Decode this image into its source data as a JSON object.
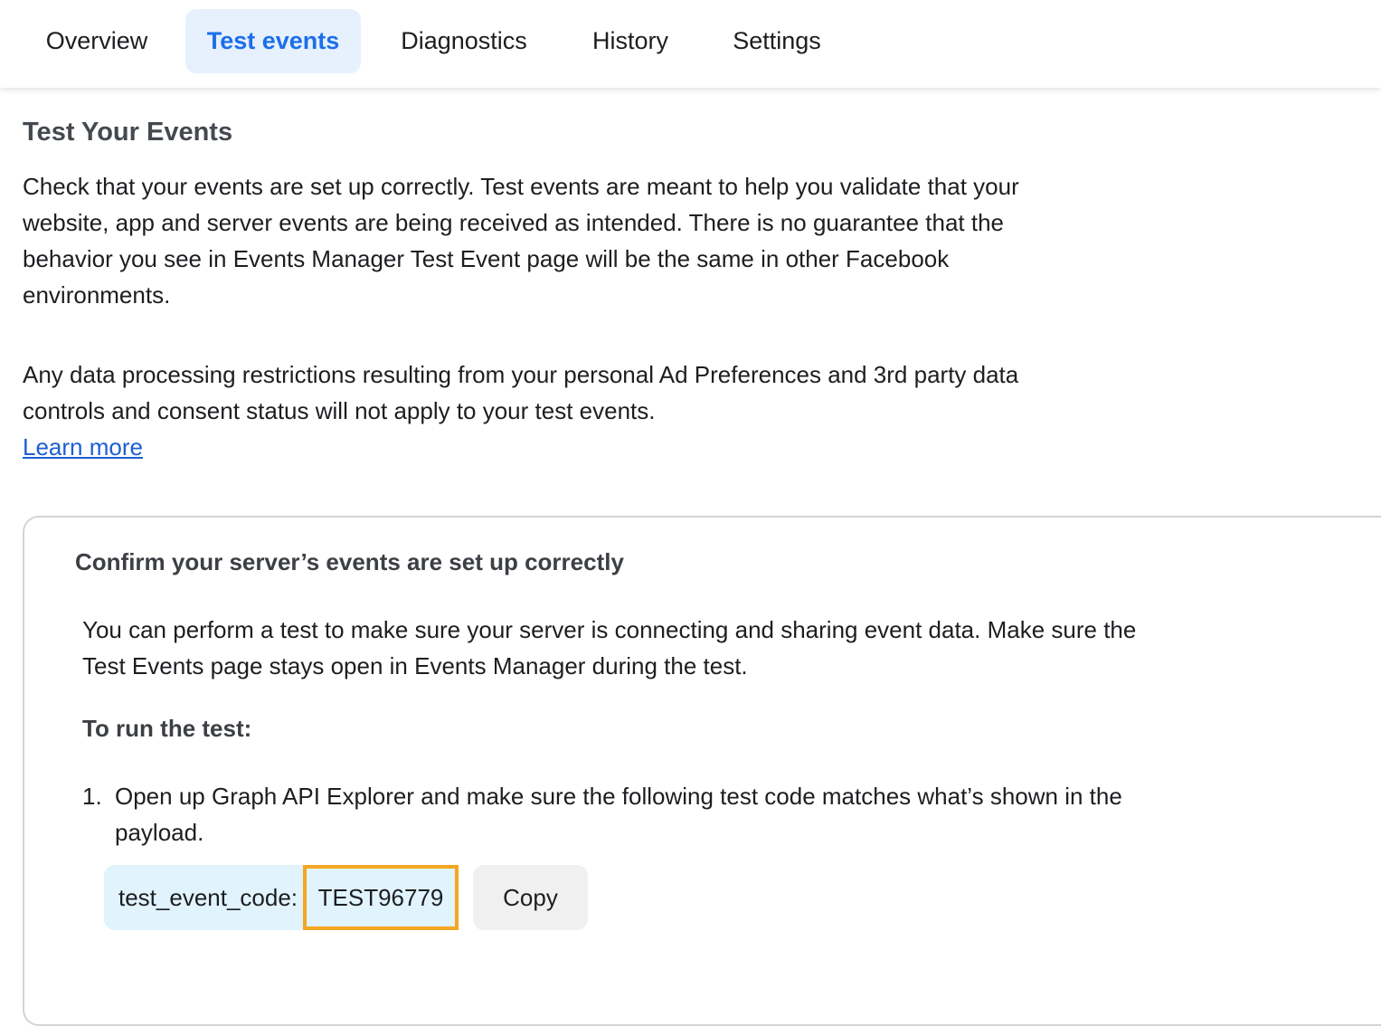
{
  "nav": {
    "tabs": [
      {
        "label": "Overview",
        "active": false
      },
      {
        "label": "Test events",
        "active": true
      },
      {
        "label": "Diagnostics",
        "active": false
      },
      {
        "label": "History",
        "active": false
      },
      {
        "label": "Settings",
        "active": false
      }
    ]
  },
  "main": {
    "heading": "Test Your Events",
    "paragraph1": "Check that your events are set up correctly. Test events are meant to help you validate that your website, app and server events are being received as intended. There is no guarantee that the behavior you see in Events Manager Test Event page will be the same in other Facebook environments.",
    "paragraph2": "Any data processing restrictions resulting from your personal Ad Preferences and 3rd party data controls and consent status will not apply to your test events.",
    "learn_more": "Learn more"
  },
  "card": {
    "title": "Confirm your server’s events are set up correctly",
    "description": "You can perform a test to make sure your server is connecting and sharing event data. Make sure the Test Events page stays open in Events Manager during the test.",
    "run_label": "To run the test:",
    "steps": [
      {
        "number": "1.",
        "text": "Open up Graph API Explorer and make sure the following test code matches what’s shown in the payload."
      }
    ],
    "code": {
      "key": "test_event_code:",
      "value": "TEST96779",
      "copy_label": "Copy"
    }
  },
  "colors": {
    "accent": "#1b6fe8",
    "active_tab_bg": "#e7f0fd",
    "link": "#1b5fd1",
    "code_bg": "#e1f3fd",
    "highlight": "#f5a623"
  }
}
